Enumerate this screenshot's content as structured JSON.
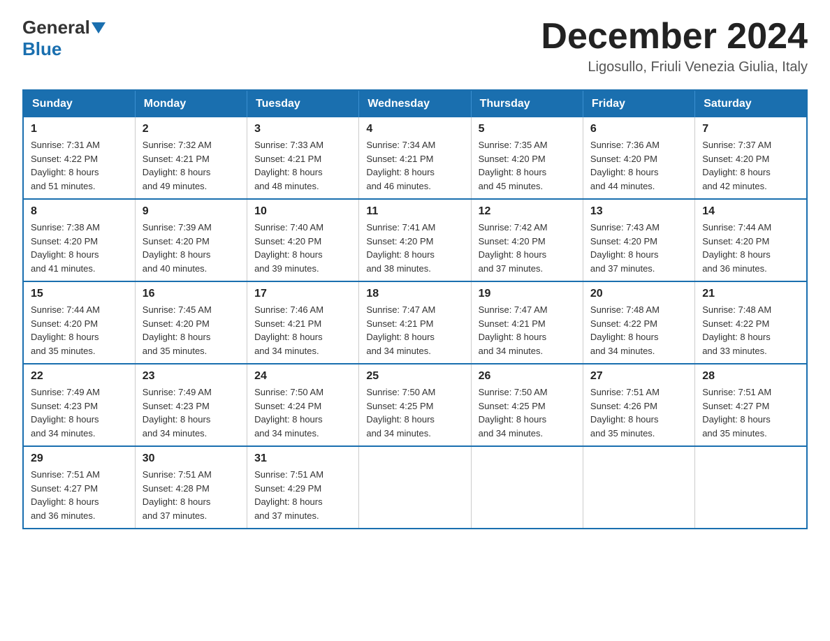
{
  "header": {
    "logo_general": "General",
    "logo_blue": "Blue",
    "month_year": "December 2024",
    "location": "Ligosullo, Friuli Venezia Giulia, Italy"
  },
  "days_of_week": [
    "Sunday",
    "Monday",
    "Tuesday",
    "Wednesday",
    "Thursday",
    "Friday",
    "Saturday"
  ],
  "weeks": [
    [
      {
        "day": 1,
        "sunrise": "7:31 AM",
        "sunset": "4:22 PM",
        "daylight": "8 hours and 51 minutes."
      },
      {
        "day": 2,
        "sunrise": "7:32 AM",
        "sunset": "4:21 PM",
        "daylight": "8 hours and 49 minutes."
      },
      {
        "day": 3,
        "sunrise": "7:33 AM",
        "sunset": "4:21 PM",
        "daylight": "8 hours and 48 minutes."
      },
      {
        "day": 4,
        "sunrise": "7:34 AM",
        "sunset": "4:21 PM",
        "daylight": "8 hours and 46 minutes."
      },
      {
        "day": 5,
        "sunrise": "7:35 AM",
        "sunset": "4:20 PM",
        "daylight": "8 hours and 45 minutes."
      },
      {
        "day": 6,
        "sunrise": "7:36 AM",
        "sunset": "4:20 PM",
        "daylight": "8 hours and 44 minutes."
      },
      {
        "day": 7,
        "sunrise": "7:37 AM",
        "sunset": "4:20 PM",
        "daylight": "8 hours and 42 minutes."
      }
    ],
    [
      {
        "day": 8,
        "sunrise": "7:38 AM",
        "sunset": "4:20 PM",
        "daylight": "8 hours and 41 minutes."
      },
      {
        "day": 9,
        "sunrise": "7:39 AM",
        "sunset": "4:20 PM",
        "daylight": "8 hours and 40 minutes."
      },
      {
        "day": 10,
        "sunrise": "7:40 AM",
        "sunset": "4:20 PM",
        "daylight": "8 hours and 39 minutes."
      },
      {
        "day": 11,
        "sunrise": "7:41 AM",
        "sunset": "4:20 PM",
        "daylight": "8 hours and 38 minutes."
      },
      {
        "day": 12,
        "sunrise": "7:42 AM",
        "sunset": "4:20 PM",
        "daylight": "8 hours and 37 minutes."
      },
      {
        "day": 13,
        "sunrise": "7:43 AM",
        "sunset": "4:20 PM",
        "daylight": "8 hours and 37 minutes."
      },
      {
        "day": 14,
        "sunrise": "7:44 AM",
        "sunset": "4:20 PM",
        "daylight": "8 hours and 36 minutes."
      }
    ],
    [
      {
        "day": 15,
        "sunrise": "7:44 AM",
        "sunset": "4:20 PM",
        "daylight": "8 hours and 35 minutes."
      },
      {
        "day": 16,
        "sunrise": "7:45 AM",
        "sunset": "4:20 PM",
        "daylight": "8 hours and 35 minutes."
      },
      {
        "day": 17,
        "sunrise": "7:46 AM",
        "sunset": "4:21 PM",
        "daylight": "8 hours and 34 minutes."
      },
      {
        "day": 18,
        "sunrise": "7:47 AM",
        "sunset": "4:21 PM",
        "daylight": "8 hours and 34 minutes."
      },
      {
        "day": 19,
        "sunrise": "7:47 AM",
        "sunset": "4:21 PM",
        "daylight": "8 hours and 34 minutes."
      },
      {
        "day": 20,
        "sunrise": "7:48 AM",
        "sunset": "4:22 PM",
        "daylight": "8 hours and 34 minutes."
      },
      {
        "day": 21,
        "sunrise": "7:48 AM",
        "sunset": "4:22 PM",
        "daylight": "8 hours and 33 minutes."
      }
    ],
    [
      {
        "day": 22,
        "sunrise": "7:49 AM",
        "sunset": "4:23 PM",
        "daylight": "8 hours and 34 minutes."
      },
      {
        "day": 23,
        "sunrise": "7:49 AM",
        "sunset": "4:23 PM",
        "daylight": "8 hours and 34 minutes."
      },
      {
        "day": 24,
        "sunrise": "7:50 AM",
        "sunset": "4:24 PM",
        "daylight": "8 hours and 34 minutes."
      },
      {
        "day": 25,
        "sunrise": "7:50 AM",
        "sunset": "4:25 PM",
        "daylight": "8 hours and 34 minutes."
      },
      {
        "day": 26,
        "sunrise": "7:50 AM",
        "sunset": "4:25 PM",
        "daylight": "8 hours and 34 minutes."
      },
      {
        "day": 27,
        "sunrise": "7:51 AM",
        "sunset": "4:26 PM",
        "daylight": "8 hours and 35 minutes."
      },
      {
        "day": 28,
        "sunrise": "7:51 AM",
        "sunset": "4:27 PM",
        "daylight": "8 hours and 35 minutes."
      }
    ],
    [
      {
        "day": 29,
        "sunrise": "7:51 AM",
        "sunset": "4:27 PM",
        "daylight": "8 hours and 36 minutes."
      },
      {
        "day": 30,
        "sunrise": "7:51 AM",
        "sunset": "4:28 PM",
        "daylight": "8 hours and 37 minutes."
      },
      {
        "day": 31,
        "sunrise": "7:51 AM",
        "sunset": "4:29 PM",
        "daylight": "8 hours and 37 minutes."
      },
      null,
      null,
      null,
      null
    ]
  ],
  "labels": {
    "sunrise": "Sunrise:",
    "sunset": "Sunset:",
    "daylight": "Daylight:"
  }
}
